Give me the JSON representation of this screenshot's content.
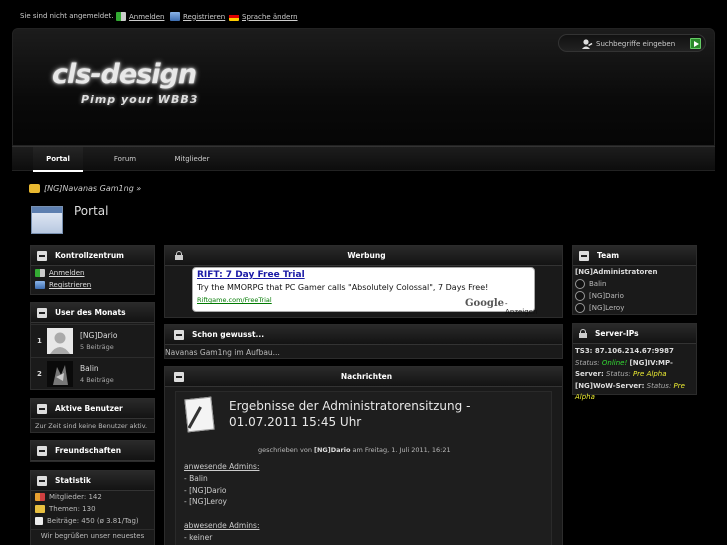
{
  "userbar": {
    "status": "Sie sind nicht angemeldet.",
    "login": "Anmelden",
    "register": "Registrieren",
    "language": "Sprache ändern"
  },
  "header": {
    "logo": "cls-design",
    "slogan": "Pimp your WBB3",
    "search_placeholder": "Suchbegriffe eingeben"
  },
  "nav": {
    "tabs": [
      {
        "label": "Portal",
        "active": true
      },
      {
        "label": "Forum",
        "active": false
      },
      {
        "label": "Mitglieder",
        "active": false
      }
    ]
  },
  "breadcrumb": "[NG]Navanas Gam1ng »",
  "page_title": "Portal",
  "left": {
    "kontrollzentrum": {
      "title": "Kontrollzentrum",
      "links": [
        "Anmelden",
        "Registrieren"
      ]
    },
    "user_des_monats": {
      "title": "User des Monats",
      "members": [
        {
          "rank": "1",
          "name": "[NG]Dario",
          "posts": "5 Beiträge"
        },
        {
          "rank": "2",
          "name": "Balin",
          "posts": "4 Beiträge"
        }
      ]
    },
    "aktive_benutzer": {
      "title": "Aktive Benutzer",
      "text": "Zur Zeit sind keine Benutzer aktiv."
    },
    "freundschaften": {
      "title": "Freundschaften"
    },
    "statistik": {
      "title": "Statistik",
      "rows": [
        "Mitglieder: 142",
        "Themen: 130",
        "Beiträge: 450 (ø 3.81/Tag)"
      ],
      "footer": "Wir begrüßen unser neuestes"
    }
  },
  "center": {
    "werbung": {
      "title": "Werbung",
      "ad_title": "RIFT: 7 Day Free Trial",
      "ad_text": "Try the MMORPG that PC Gamer calls \"Absolutely Colossal\", 7 Days Free!",
      "ad_url": "Riftgame.com/FreeTrial",
      "ad_brand": "Google",
      "ad_suffix": "-Anzeigen"
    },
    "schon_gewusst": {
      "title": "Schon gewusst...",
      "text": "Navanas Gam1ng im Aufbau..."
    },
    "nachrichten": {
      "title": "Nachrichten",
      "news_title": "Ergebnisse der Administratorensitzung - 01.07.2011 15:45 Uhr",
      "meta_prefix": "geschrieben von ",
      "meta_author": "[NG]Dario",
      "meta_suffix": " am Freitag, 1. Juli 2011, 16:21",
      "body": [
        {
          "text": "anwesende Admins:",
          "underline": true
        },
        {
          "text": "- Balin",
          "underline": false
        },
        {
          "text": "- [NG]Dario",
          "underline": false
        },
        {
          "text": "- [NG]Leroy",
          "underline": false
        },
        {
          "text": "",
          "underline": false
        },
        {
          "text": "abwesende Admins:",
          "underline": true
        },
        {
          "text": "- keiner",
          "underline": false
        }
      ]
    }
  },
  "right": {
    "team": {
      "title": "Team",
      "group": "[NG]Administratoren",
      "members": [
        "Balin",
        "[NG]Dario",
        "[NG]Leroy"
      ]
    },
    "server_ips": {
      "title": "Server-IPs",
      "ts3_label": "TS3: 87.106.214.67:9987",
      "status_label": "Status:",
      "ts3_status": "Online!",
      "iv_label": "[NG]IV:MP-Server:",
      "iv_status_label": "Status:",
      "iv_status": "Pre Alpha",
      "wow_label": "[NG]WoW-Server:",
      "wow_status_label": "Status:",
      "wow_status": "Pre Alpha"
    }
  },
  "colors": {
    "online": "#33dd33",
    "alpha": "#eeee33",
    "ad_title": "#1a1aa6",
    "ad_url": "#007a00"
  }
}
